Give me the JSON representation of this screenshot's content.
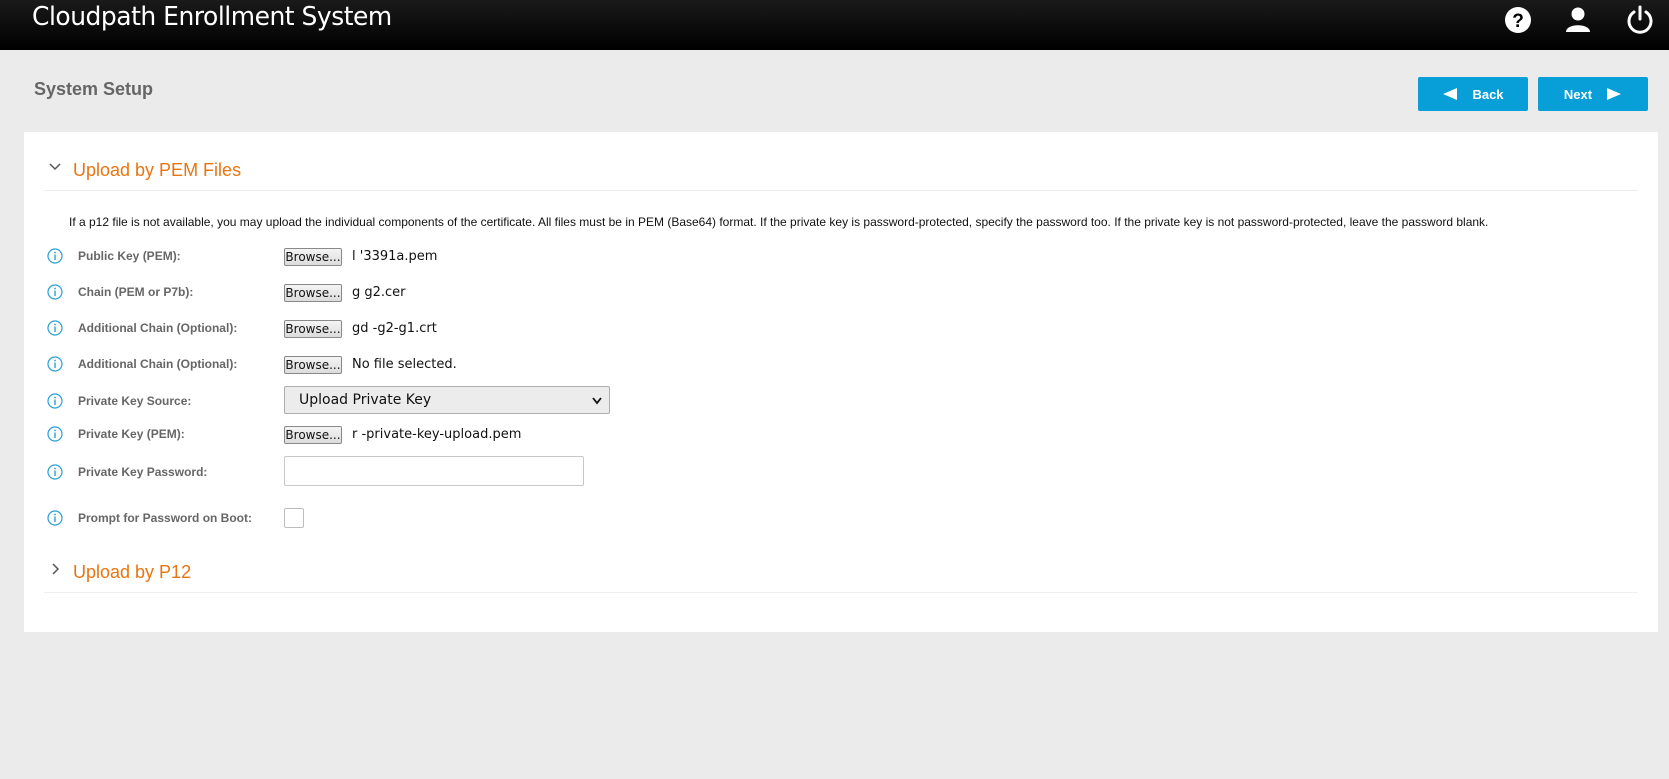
{
  "header": {
    "app_title": "Cloudpath Enrollment System",
    "icons": [
      "help-icon",
      "user-icon",
      "power-icon"
    ]
  },
  "page": {
    "title": "System Setup",
    "back_label": "Back",
    "next_label": "Next"
  },
  "colors": {
    "accent": "#089ed8",
    "section_heading": "#e87511",
    "topbar": "#000000"
  },
  "pem_section": {
    "heading": "Upload by PEM Files",
    "expanded": true,
    "description": "If a p12 file is not available, you may upload the individual components of the certificate. All files must be in PEM (Base64) format. If the private key is password-protected, specify the password too. If the private key is not password-protected, leave the password blank.",
    "browse_label": "Browse...",
    "fields": {
      "public_key": {
        "label": "Public Key (PEM):",
        "file": "l          '3391a.pem"
      },
      "chain": {
        "label": "Chain (PEM or P7b):",
        "file": "g       g2.cer"
      },
      "additional_chain_1": {
        "label": "Additional Chain (Optional):",
        "file": "gd        -g2-g1.crt"
      },
      "additional_chain_2": {
        "label": "Additional Chain (Optional):",
        "file": "No file selected."
      },
      "private_key_source": {
        "label": "Private Key Source:",
        "selected": "Upload Private Key"
      },
      "private_key": {
        "label": "Private Key (PEM):",
        "file": "r            -private-key-upload.pem"
      },
      "private_key_password": {
        "label": "Private Key Password:",
        "value": ""
      },
      "prompt_password_boot": {
        "label": "Prompt for Password on Boot:",
        "checked": false
      }
    }
  },
  "p12_section": {
    "heading": "Upload by P12",
    "expanded": false
  }
}
